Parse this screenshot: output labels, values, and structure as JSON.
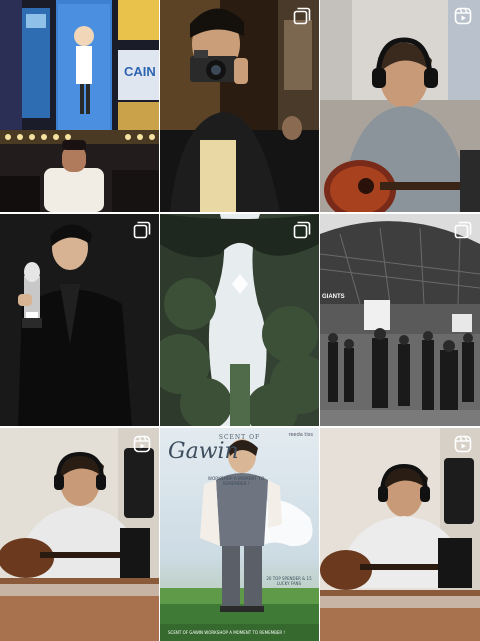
{
  "grid": {
    "columns": 3,
    "rows": 3,
    "posts": [
      {
        "id": 1,
        "scene": "Man in white t-shirt on a night street under neon billboards",
        "badge": "none",
        "sign_text": "CAIN"
      },
      {
        "id": 2,
        "scene": "Man taking a mirror selfie with a film camera",
        "badge": "multi-image-icon"
      },
      {
        "id": 3,
        "scene": "Man with headphones playing acoustic guitar",
        "badge": "reel-icon"
      },
      {
        "id": 4,
        "scene": "Man in black suit holding a trophy",
        "badge": "multi-image-icon"
      },
      {
        "id": 5,
        "scene": "Looking up at a forest canopy",
        "badge": "multi-image-icon"
      },
      {
        "id": 6,
        "scene": "Black and white crowd outside a stadium",
        "badge": "multi-image-icon",
        "sign_text": "GIANTS"
      },
      {
        "id": 7,
        "scene": "Man with headphones playing guitar at a desk",
        "badge": "reel-icon"
      },
      {
        "id": 8,
        "scene": "Event poster with a man in a vest on grass",
        "badge": "reel-icon",
        "poster": {
          "title_small": "SCENT OF",
          "title_large": "Gawin",
          "subtitle": "WORKSHOP A MOMENT TO REMEMBER !",
          "brand": "reeda tiss",
          "top_spender": "20 TOP SPENDER & 15 LUCKY FANS",
          "footer": "SCENT OF GAWIN WORKSHOP A MOMENT TO REMEMBER !"
        }
      },
      {
        "id": 9,
        "scene": "Man with headphones playing guitar at a desk",
        "badge": "reel-icon"
      }
    ]
  },
  "colors": {
    "icon": "#ffffff",
    "gap": "#ffffff"
  }
}
